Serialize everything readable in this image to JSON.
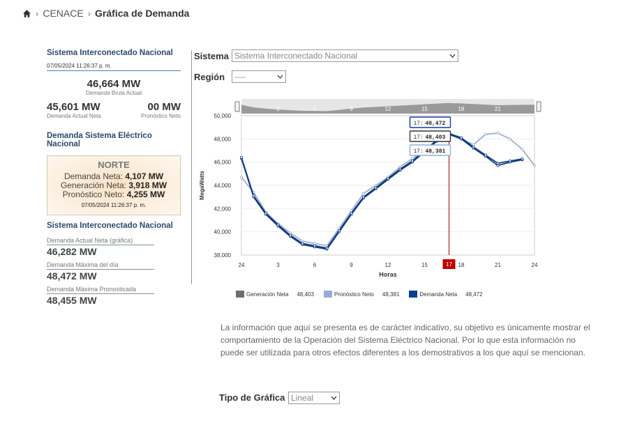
{
  "breadcrumb": {
    "parent": "CENACE",
    "current": "Gráfica de Demanda"
  },
  "left": {
    "sin_title": "Sistema Interconectado Nacional",
    "timestamp": "07/05/2024 11:26:37 p. m.",
    "bruta_value": "46,664 MW",
    "bruta_label": "Demanda Bruta Actual",
    "neta_value": "45,601 MW",
    "neta_label": "Demanda Actual Neta",
    "pron_value": "00 MW",
    "pron_label": "Pronóstico Neto",
    "dsen_title": "Demanda Sistema Eléctrico Nacional",
    "region": {
      "name": "NORTE",
      "demanda_label": "Demanda Neta:",
      "demanda_value": "4,107 MW",
      "generacion_label": "Generación Neta:",
      "generacion_value": "3,918 MW",
      "pronostico_label": "Pronóstico Neto:",
      "pronostico_value": "4,255 MW",
      "timestamp": "07/05/2024 11:26:37 p. m."
    },
    "sin2_title": "Sistema Interconectado Nacional",
    "stats": [
      {
        "label": "Demanda Actual Neta (gráfica)",
        "value": "46,282 MW"
      },
      {
        "label": "Demanda Máxima del día",
        "value": "48,472 MW"
      },
      {
        "label": "Demanda Máxima Pronosticada",
        "value": "48,455 MW"
      }
    ]
  },
  "controls": {
    "sistema_label": "Sistema",
    "sistema_value": "Sistema Interconectado Nacional",
    "region_label": "Región",
    "region_value": "----",
    "tipo_label": "Tipo de Gráfica",
    "tipo_value": "Lineal"
  },
  "chart_data": {
    "type": "line",
    "xlabel": "Horas",
    "ylabel": "MegaWatts",
    "x_ticks": [
      "24",
      "3",
      "6",
      "9",
      "12",
      "15",
      "18",
      "21",
      "24"
    ],
    "navigator_ticks": [
      "3",
      "6",
      "9",
      "12",
      "15",
      "18",
      "21"
    ],
    "ylim": [
      38000,
      50000
    ],
    "y_ticks": [
      "38,000",
      "40,000",
      "42,000",
      "44,000",
      "46,000",
      "48,000",
      "50,000"
    ],
    "x": [
      0,
      1,
      2,
      3,
      4,
      5,
      6,
      7,
      8,
      9,
      10,
      11,
      12,
      13,
      14,
      15,
      16,
      17,
      18,
      19,
      20,
      21,
      22,
      23,
      24
    ],
    "series": [
      {
        "name": "Generación Neta",
        "color": "#1f3f6e",
        "values": [
          46300,
          43000,
          41500,
          40500,
          39600,
          38900,
          38700,
          38500,
          40000,
          41500,
          42900,
          43700,
          44500,
          45300,
          46000,
          46900,
          47800,
          48403,
          48000,
          47200,
          46500,
          45700,
          46000,
          46200,
          null
        ]
      },
      {
        "name": "Pronóstico Neto",
        "color": "#9bb0cc",
        "values": [
          44700,
          43400,
          41700,
          40700,
          39900,
          39200,
          39000,
          38800,
          40300,
          41800,
          43300,
          44000,
          44700,
          45600,
          46300,
          47000,
          47900,
          48381,
          48000,
          47500,
          48400,
          48500,
          48000,
          47100,
          45700
        ]
      },
      {
        "name": "Demanda Neta",
        "color": "#0b3a8c",
        "values": [
          46400,
          43100,
          41600,
          40600,
          39700,
          39000,
          38800,
          38600,
          40100,
          41600,
          43000,
          43800,
          44600,
          45400,
          46100,
          47000,
          47900,
          48472,
          48100,
          47300,
          46600,
          45900,
          46100,
          46282,
          null
        ]
      }
    ],
    "highlight_x": 17,
    "highlight_label": "17",
    "tooltips": [
      {
        "hour": "17:",
        "value": "48,472"
      },
      {
        "hour": "17:",
        "value": "48,403"
      },
      {
        "hour": "17:",
        "value": "48,381"
      }
    ],
    "legend": [
      {
        "name": "Generación Neta",
        "value": "48,403",
        "color": "#6e6e6e"
      },
      {
        "name": "Pronóstico Neto",
        "value": "48,381",
        "color": "#93aed6"
      },
      {
        "name": "Demanda Neta",
        "value": "48,472",
        "color": "#0d3f91"
      }
    ]
  },
  "info_text": "La información que aquí se presenta es de carácter indicativo, su objetivo es únicamente mostrar el comportamiento de la Operación del Sistema Eléctrico Nacional. Por lo que esta información no puede ser utilizada para otros efectos diferentes a los demostrativos a los que aquí se mencionan."
}
